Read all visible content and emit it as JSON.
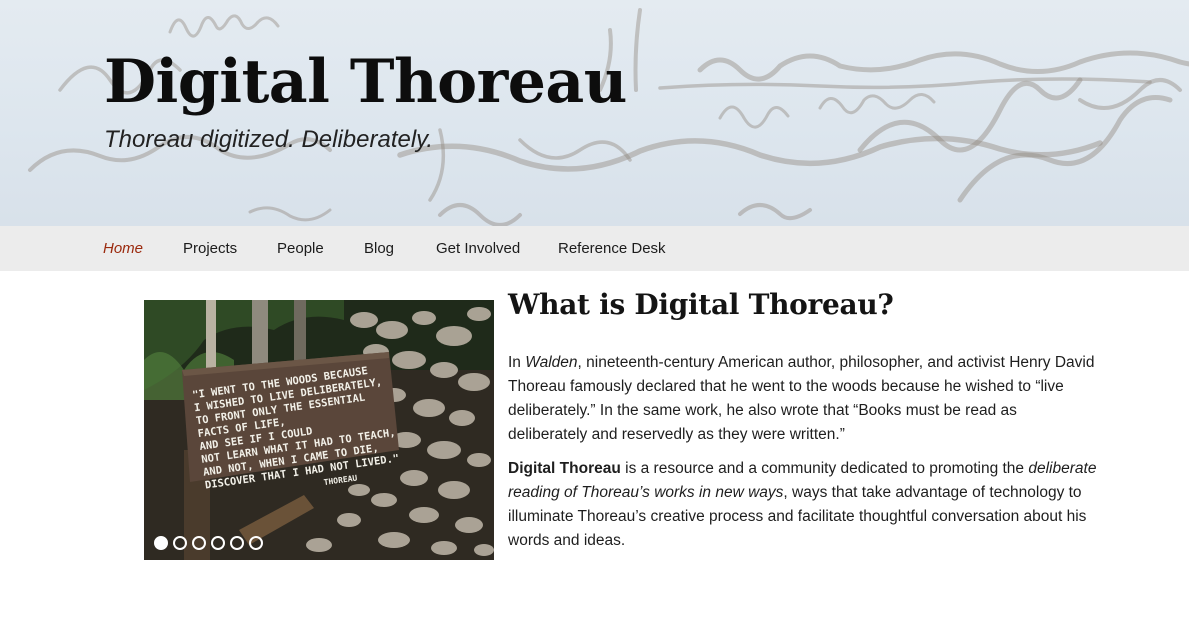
{
  "header": {
    "title": "Digital Thoreau",
    "tagline": "Thoreau digitized. Deliberately.",
    "background": "handwritten-manuscript"
  },
  "nav": {
    "items": [
      {
        "label": "Home",
        "active": true
      },
      {
        "label": "Projects"
      },
      {
        "label": "People"
      },
      {
        "label": "Blog"
      },
      {
        "label": "Get Involved"
      },
      {
        "label": "Reference Desk"
      }
    ],
    "active_color": "#9b2a0e"
  },
  "slider": {
    "sign_text": "\"I WENT TO THE WOODS BECAUSE I WISHED TO LIVE DELIBERATELY, TO FRONT ONLY THE ESSENTIAL FACTS OF LIFE, AND SEE IF I COULD NOT LEARN WHAT IT HAD TO TEACH, AND NOT, WHEN I CAME TO DIE, DISCOVER THAT I HAD NOT LIVED.\" THOREAU",
    "slide_count": 6,
    "active_slide": 1
  },
  "intro": {
    "heading": "What is Digital Thoreau?",
    "p1": {
      "s1": "In ",
      "s2": "Walden",
      "s3": ", nineteenth-century American author, philosopher, and activist Henry David Thoreau famously declared that he went to the woods because he wished to “live deliberately.” In the same work, he also wrote that “Books must be read as deliberately and reservedly as they were written.”"
    },
    "p2": {
      "s1": "Digital Thoreau",
      "s2": " is a resource and a community dedicated to promoting the ",
      "s3": "deliberate reading of Thoreau’s works in new ways",
      "s4": ", ways that take advantage of technology to illuminate Thoreau’s creative process and facilitate thoughtful conversation about his words and ideas."
    }
  }
}
